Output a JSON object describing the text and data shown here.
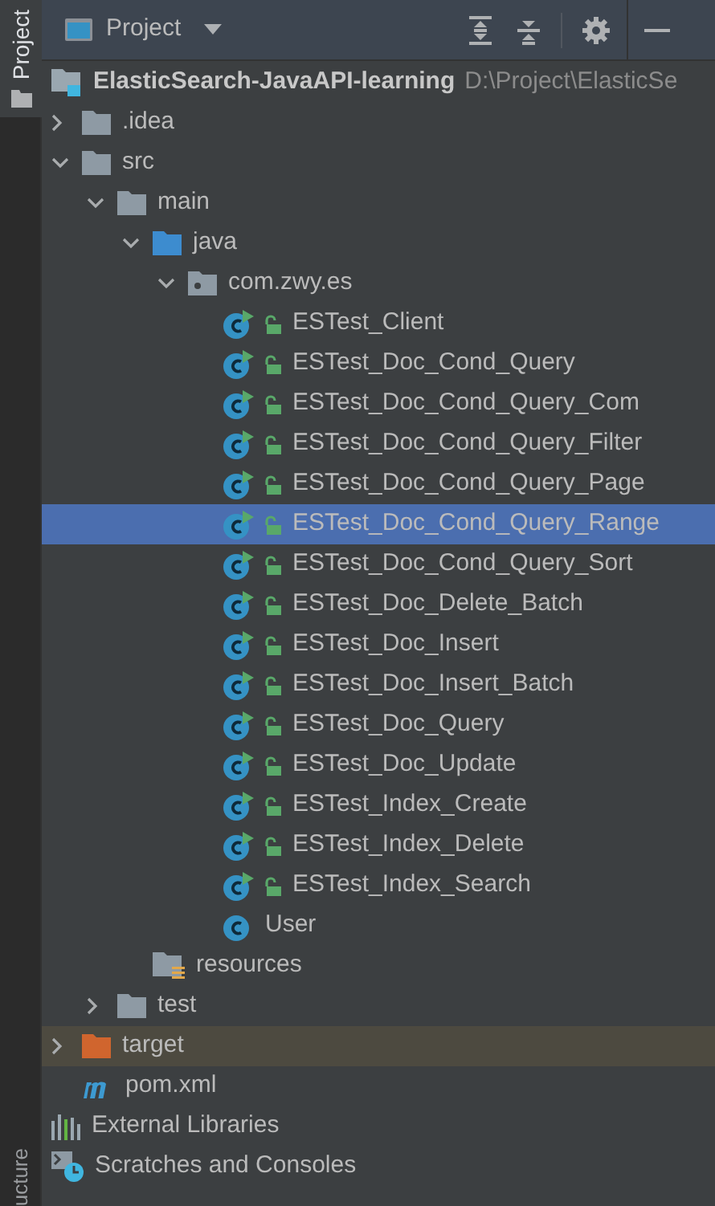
{
  "side_strip": {
    "tabs": [
      {
        "label": "Project",
        "selected": true
      }
    ],
    "bottom_tab": {
      "label": "ucture"
    }
  },
  "header": {
    "title": "Project"
  },
  "tree": [
    {
      "kind": "project",
      "label": "ElasticSearch-JavaAPI-learning",
      "path": "D:\\Project\\ElasticSe",
      "selected": false,
      "children": [
        {
          "kind": "folder",
          "label": ".idea",
          "selected": false,
          "expanded": false
        },
        {
          "kind": "folder",
          "label": "src",
          "selected": false,
          "expanded": true,
          "children": [
            {
              "kind": "folder",
              "label": "main",
              "selected": false,
              "expanded": true,
              "children": [
                {
                  "kind": "source-folder",
                  "label": "java",
                  "selected": false,
                  "expanded": true,
                  "children": [
                    {
                      "kind": "package",
                      "label": "com.zwy.es",
                      "selected": false,
                      "expanded": true,
                      "children": [
                        {
                          "kind": "class",
                          "label": "ESTest_Client",
                          "selected": false,
                          "runnable": true,
                          "locked": true
                        },
                        {
                          "kind": "class",
                          "label": "ESTest_Doc_Cond_Query",
                          "selected": false,
                          "runnable": true,
                          "locked": true
                        },
                        {
                          "kind": "class",
                          "label": "ESTest_Doc_Cond_Query_Com",
                          "selected": false,
                          "runnable": true,
                          "locked": true
                        },
                        {
                          "kind": "class",
                          "label": "ESTest_Doc_Cond_Query_Filter",
                          "selected": false,
                          "runnable": true,
                          "locked": true
                        },
                        {
                          "kind": "class",
                          "label": "ESTest_Doc_Cond_Query_Page",
                          "selected": false,
                          "runnable": true,
                          "locked": true
                        },
                        {
                          "kind": "class",
                          "label": "ESTest_Doc_Cond_Query_Range",
                          "selected": true,
                          "runnable": true,
                          "locked": true
                        },
                        {
                          "kind": "class",
                          "label": "ESTest_Doc_Cond_Query_Sort",
                          "selected": false,
                          "runnable": true,
                          "locked": true
                        },
                        {
                          "kind": "class",
                          "label": "ESTest_Doc_Delete_Batch",
                          "selected": false,
                          "runnable": true,
                          "locked": true
                        },
                        {
                          "kind": "class",
                          "label": "ESTest_Doc_Insert",
                          "selected": false,
                          "runnable": true,
                          "locked": true
                        },
                        {
                          "kind": "class",
                          "label": "ESTest_Doc_Insert_Batch",
                          "selected": false,
                          "runnable": true,
                          "locked": true
                        },
                        {
                          "kind": "class",
                          "label": "ESTest_Doc_Query",
                          "selected": false,
                          "runnable": true,
                          "locked": true
                        },
                        {
                          "kind": "class",
                          "label": "ESTest_Doc_Update",
                          "selected": false,
                          "runnable": true,
                          "locked": true
                        },
                        {
                          "kind": "class",
                          "label": "ESTest_Index_Create",
                          "selected": false,
                          "runnable": true,
                          "locked": true
                        },
                        {
                          "kind": "class",
                          "label": "ESTest_Index_Delete",
                          "selected": false,
                          "runnable": true,
                          "locked": true
                        },
                        {
                          "kind": "class",
                          "label": "ESTest_Index_Search",
                          "selected": false,
                          "runnable": true,
                          "locked": true
                        },
                        {
                          "kind": "class",
                          "label": "User",
                          "selected": false,
                          "runnable": false,
                          "locked": false
                        }
                      ]
                    }
                  ]
                },
                {
                  "kind": "resources",
                  "label": "resources",
                  "selected": false
                }
              ]
            },
            {
              "kind": "folder",
              "label": "test",
              "selected": false,
              "expanded": false
            }
          ]
        },
        {
          "kind": "excluded-folder",
          "label": "target",
          "selected": false,
          "expanded": false
        },
        {
          "kind": "maven",
          "label": "pom.xml",
          "selected": false
        }
      ]
    },
    {
      "kind": "libraries",
      "label": "External Libraries",
      "selected": false
    },
    {
      "kind": "scratches",
      "label": "Scratches and Consoles",
      "selected": false
    }
  ]
}
